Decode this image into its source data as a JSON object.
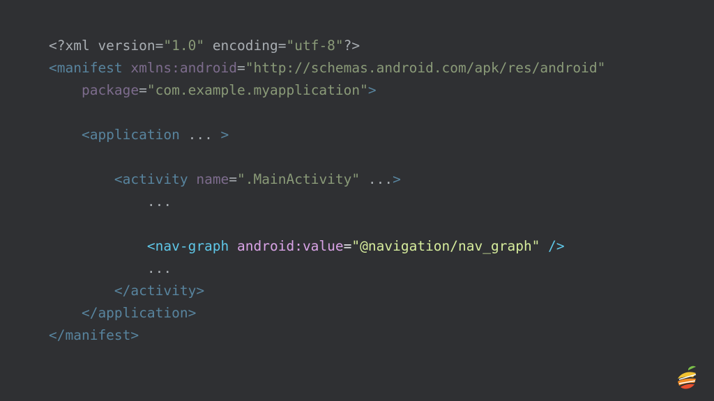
{
  "colors": {
    "background": "#2f3033",
    "dim_text": "#a9aeb3",
    "dim_tag": "#58849e",
    "dim_attr": "#7d6c8d",
    "dim_string": "#8a9a78",
    "hi_tag": "#5fc7e8",
    "hi_attr": "#d9a3e6",
    "hi_string": "#d6ec9c",
    "hi_punct": "#e6e8ea"
  },
  "code": {
    "lines": [
      [
        {
          "t": "<?xml version=",
          "c": "dim-text"
        },
        {
          "t": "\"1.0\"",
          "c": "dim-str"
        },
        {
          "t": " encoding=",
          "c": "dim-text"
        },
        {
          "t": "\"utf-8\"",
          "c": "dim-str"
        },
        {
          "t": "?>",
          "c": "dim-text"
        }
      ],
      [
        {
          "t": "<manifest",
          "c": "dim-tag"
        },
        {
          "t": " xmlns:android",
          "c": "dim-attr"
        },
        {
          "t": "=",
          "c": "dim-punct"
        },
        {
          "t": "\"http://schemas.android.com/apk/res/android\"",
          "c": "dim-str"
        }
      ],
      [
        {
          "t": "    package",
          "c": "dim-attr"
        },
        {
          "t": "=",
          "c": "dim-punct"
        },
        {
          "t": "\"com.example.myapplication\"",
          "c": "dim-str"
        },
        {
          "t": ">",
          "c": "dim-tag"
        }
      ],
      [],
      [
        {
          "t": "    <application",
          "c": "dim-tag"
        },
        {
          "t": " ... ",
          "c": "dim-text"
        },
        {
          "t": ">",
          "c": "dim-tag"
        }
      ],
      [],
      [
        {
          "t": "        <activity",
          "c": "dim-tag"
        },
        {
          "t": " name",
          "c": "dim-attr"
        },
        {
          "t": "=",
          "c": "dim-punct"
        },
        {
          "t": "\".MainActivity\"",
          "c": "dim-str"
        },
        {
          "t": " ...",
          "c": "dim-text"
        },
        {
          "t": ">",
          "c": "dim-tag"
        }
      ],
      [
        {
          "t": "            ...",
          "c": "dim-text"
        }
      ],
      [],
      [
        {
          "t": "            <nav-graph",
          "c": "hi-tag"
        },
        {
          "t": " android:value",
          "c": "hi-attr"
        },
        {
          "t": "=",
          "c": "hi-punct"
        },
        {
          "t": "\"@navigation/nav_graph\"",
          "c": "hi-str"
        },
        {
          "t": " />",
          "c": "hi-tag"
        }
      ],
      [
        {
          "t": "            ...",
          "c": "dim-text"
        }
      ],
      [
        {
          "t": "        </activity>",
          "c": "dim-tag"
        }
      ],
      [
        {
          "t": "    </application>",
          "c": "dim-tag"
        }
      ],
      [
        {
          "t": "</manifest>",
          "c": "dim-tag"
        }
      ]
    ]
  },
  "logo": {
    "icon": "orange-slice-logo-icon"
  }
}
